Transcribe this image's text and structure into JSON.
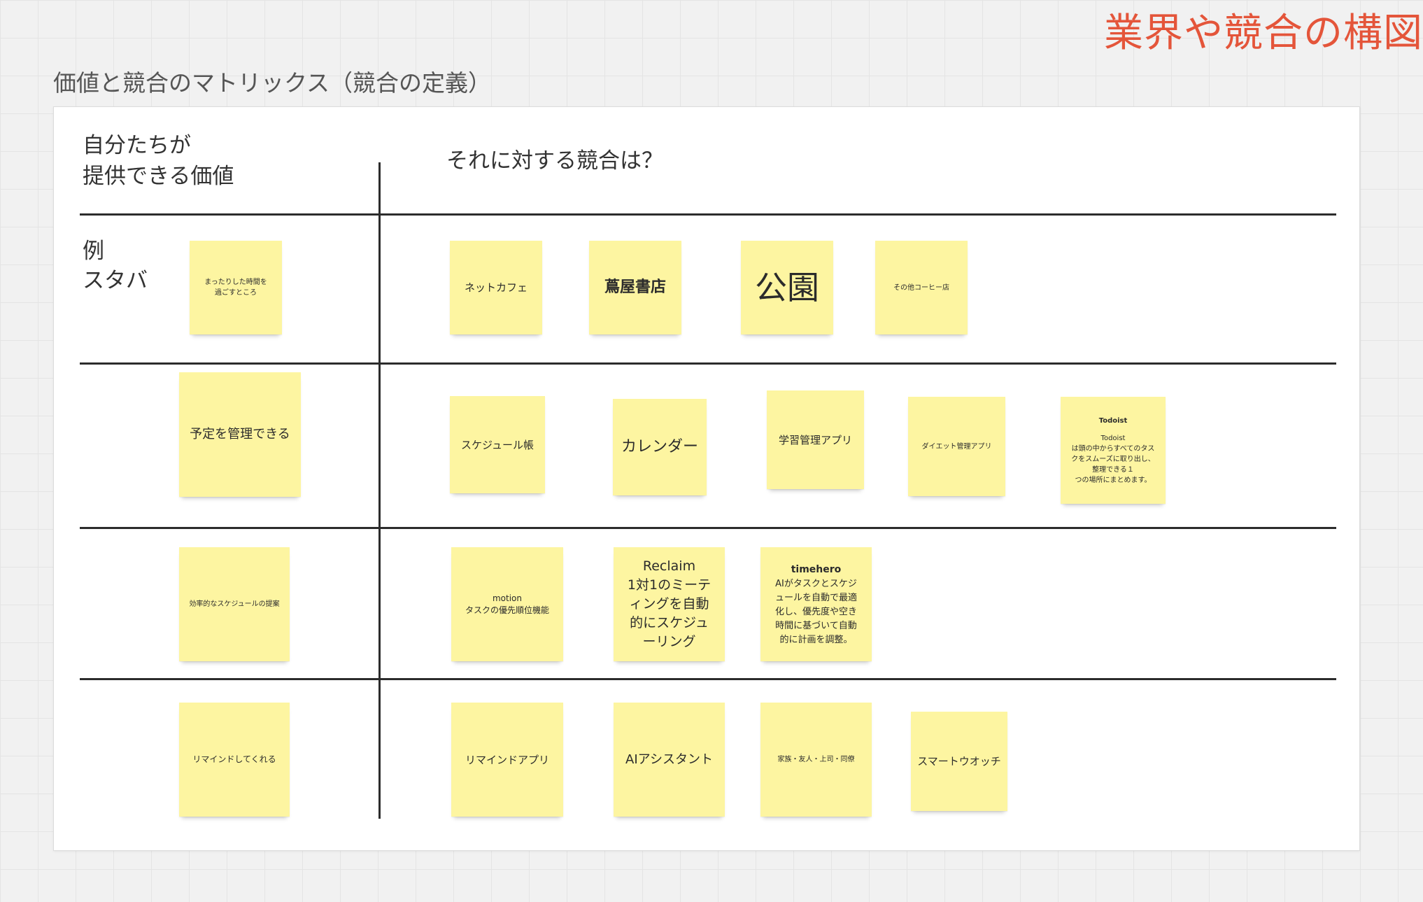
{
  "corner_title": "業界や競合の構図",
  "frame_label": "価値と競合のマトリックス（競合の定義）",
  "headers": {
    "left": "自分たちが\n提供できる価値",
    "right": "それに対する競合は？"
  },
  "rows": [
    {
      "label": "例\nスタバ",
      "value_note": "まったりした時間を\n過ごすところ",
      "competitors": [
        "ネットカフェ",
        "蔦屋書店",
        "公園",
        "その他コーヒー店"
      ]
    },
    {
      "value_note": "予定を管理できる",
      "competitors": [
        "スケジュール帳",
        "カレンダー",
        "学習管理アプリ",
        "ダイエット管理アプリ"
      ],
      "todoist": {
        "title": "Todoist",
        "body": "Todoist\nは頭の中からすべてのタス\nクをスムーズに取り出し、\n整理できる１\nつの場所にまとめます。"
      }
    },
    {
      "value_note": "効率的なスケジュールの提案",
      "motion": "motion\nタスクの優先順位機能",
      "reclaim": "Reclaim\n1対1のミーテ\nィングを自動\n的にスケジュ\nーリング",
      "timehero": {
        "title": "timehero",
        "body": "AIがタスクとスケジ\nュールを自動で最適\n化し、優先度や空き\n時間に基づいて自動\n的に計画を調整。"
      }
    },
    {
      "value_note": "リマインドしてくれる",
      "competitors": [
        "リマインドアプリ",
        "AIアシスタント",
        "家族・友人・上司・同僚",
        "スマートウオッチ"
      ]
    }
  ]
}
